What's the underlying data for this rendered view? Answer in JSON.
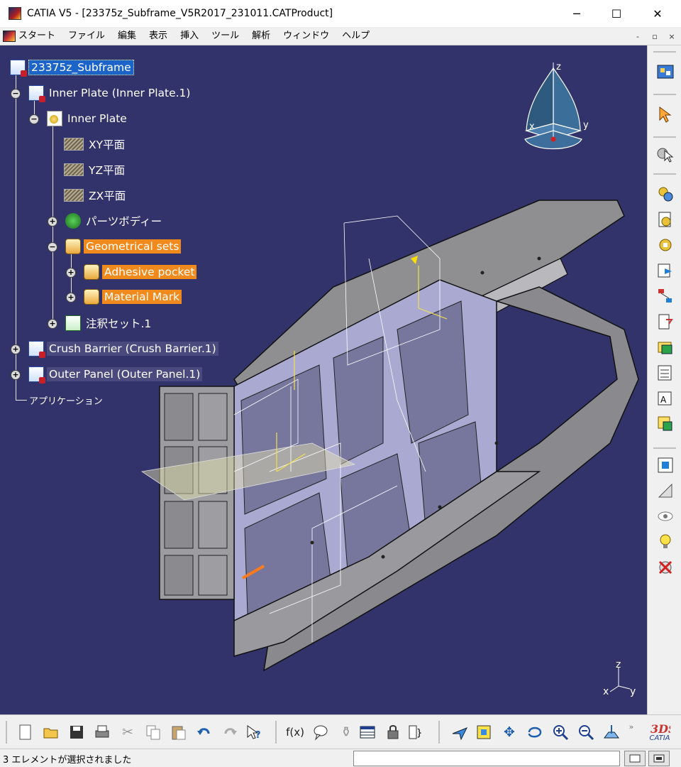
{
  "window": {
    "title": "CATIA V5 - [23375z_Subframe_V5R2017_231011.CATProduct]",
    "minimize": "─",
    "maximize": "☐",
    "close": "✕"
  },
  "menu": {
    "items": [
      "スタート",
      "ファイル",
      "編集",
      "表示",
      "挿入",
      "ツール",
      "解析",
      "ウィンドウ",
      "ヘルプ"
    ],
    "mdi_minimize": "-",
    "mdi_restore": "▫",
    "mdi_close": "×"
  },
  "tree": {
    "nodes": [
      {
        "label": "23375z_Subframe",
        "icon": "product-icon",
        "style": "selected"
      },
      {
        "label": "Inner Plate (Inner Plate.1)",
        "icon": "product-icon",
        "expander": "−"
      },
      {
        "label": "Inner Plate",
        "icon": "part-icon",
        "expander": "−"
      },
      {
        "label": "XY平面",
        "icon": "plane-icon"
      },
      {
        "label": "YZ平面",
        "icon": "plane-icon"
      },
      {
        "label": "ZX平面",
        "icon": "plane-icon"
      },
      {
        "label": "パーツボディー",
        "icon": "body-icon",
        "expander": "+"
      },
      {
        "label": "Geometrical sets",
        "icon": "geometrical-set-icon",
        "expander": "−",
        "style": "highlighted"
      },
      {
        "label": "Adhesive pocket",
        "icon": "geometrical-set-icon",
        "expander": "+",
        "style": "highlighted"
      },
      {
        "label": "Material Mark",
        "icon": "geometrical-set-icon",
        "expander": "+",
        "style": "highlighted"
      },
      {
        "label": "注釈セット.1",
        "icon": "annotation-set-icon",
        "expander": "+"
      },
      {
        "label": "Crush Barrier (Crush Barrier.1)",
        "icon": "product-icon",
        "expander": "+",
        "style": "dim"
      },
      {
        "label": "Outer Panel (Outer Panel.1)",
        "icon": "product-icon",
        "expander": "+",
        "style": "dim"
      },
      {
        "label": "アプリケーション",
        "icon": ""
      }
    ]
  },
  "compass": {
    "x": "x",
    "y": "y",
    "z": "z"
  },
  "axis_triad": {
    "x": "x",
    "y": "y",
    "z": "z"
  },
  "right_toolbar": {
    "icons": [
      "product-workbench-icon",
      "select-arrow-icon",
      "select-mode-icon",
      "insert-component-icon",
      "existing-component-icon",
      "existing-component-position-icon",
      "replace-component-icon",
      "graph-tree-reorder-icon",
      "generate-numbering-icon",
      "selective-load-icon",
      "manage-representations-icon",
      "multi-instantiation-icon",
      "bill-of-material-icon",
      "flexible-assembly-icon",
      "fix-component-icon",
      "hide-show-icon",
      "lightbulb-icon",
      "clash-icon"
    ]
  },
  "bottom_toolbar": {
    "icons": [
      "new-icon",
      "open-icon",
      "save-icon",
      "print-icon",
      "cut-icon",
      "copy-icon",
      "paste-icon",
      "undo-icon",
      "redo-icon",
      "whats-this-icon",
      "formula-icon",
      "knowledge-advisor-icon",
      "measure-icon",
      "table-icon",
      "lock-icon",
      "macros-icon",
      "fly-mode-icon",
      "fit-all-icon",
      "pan-icon",
      "rotate-icon",
      "zoom-in-icon",
      "zoom-out-icon",
      "normal-view-icon",
      "more-icon",
      "catia-logo-icon"
    ],
    "logo_text": "CATIA"
  },
  "status_bar": {
    "message": "3 エレメントが選択されました",
    "command_input": ""
  },
  "colors": {
    "viewport_background": "#33336b",
    "selection": "#1c64c8",
    "highlight": "#f08a1c"
  }
}
